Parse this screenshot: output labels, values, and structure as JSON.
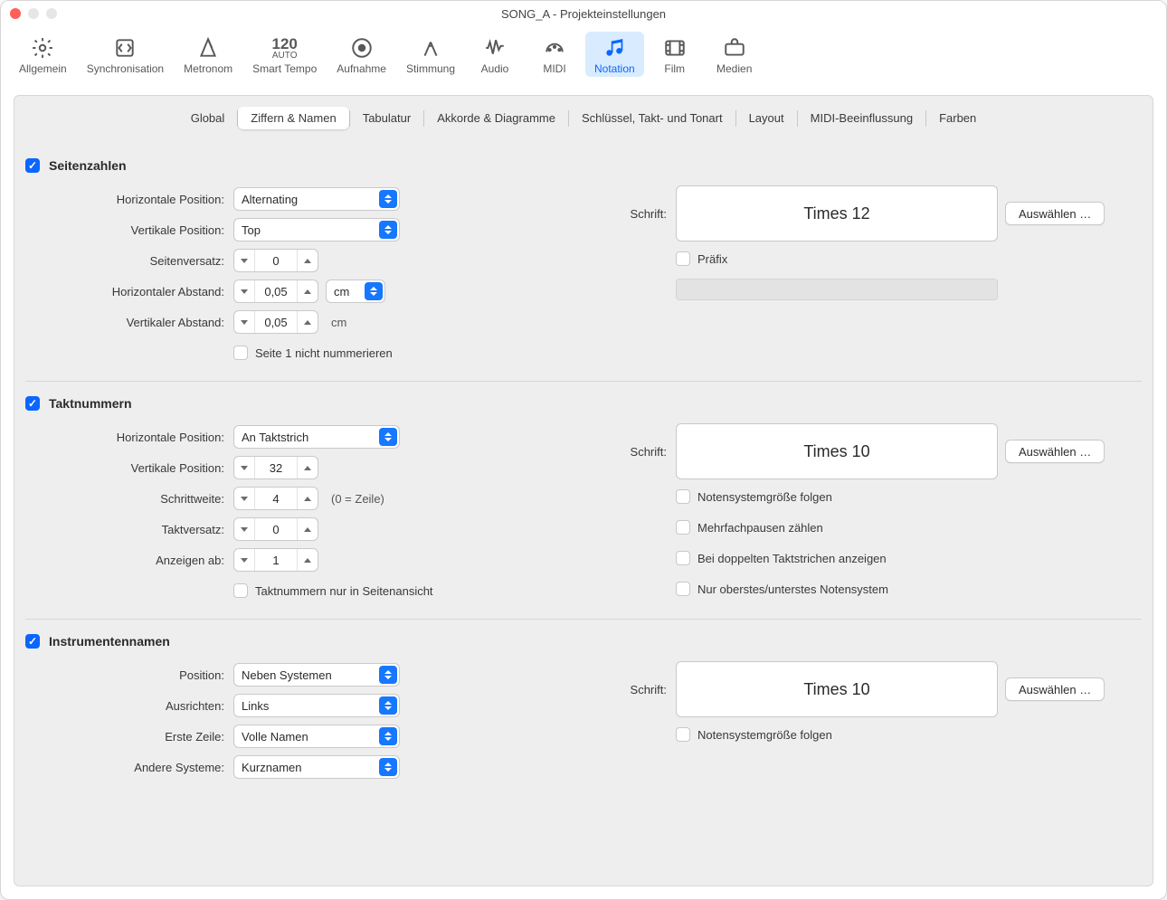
{
  "window": {
    "title": "SONG_A - Projekteinstellungen"
  },
  "toolbar": {
    "items": [
      {
        "label": "Allgemein",
        "icon": "gear"
      },
      {
        "label": "Synchronisation",
        "icon": "sync"
      },
      {
        "label": "Metronom",
        "icon": "metronome"
      },
      {
        "label": "Smart Tempo",
        "icon": "auto120"
      },
      {
        "label": "Aufnahme",
        "icon": "record"
      },
      {
        "label": "Stimmung",
        "icon": "fork"
      },
      {
        "label": "Audio",
        "icon": "wave"
      },
      {
        "label": "MIDI",
        "icon": "midi"
      },
      {
        "label": "Notation",
        "icon": "notes"
      },
      {
        "label": "Film",
        "icon": "film"
      },
      {
        "label": "Medien",
        "icon": "case"
      }
    ],
    "activeIndex": 8
  },
  "subtabs": [
    "Global",
    "Ziffern & Namen",
    "Tabulatur",
    "Akkorde & Diagramme",
    "Schlüssel, Takt- und Tonart",
    "Layout",
    "MIDI-Beeinflussung",
    "Farben"
  ],
  "subtabActive": 1,
  "pageNumbers": {
    "title": "Seitenzahlen",
    "checked": true,
    "hPosLabel": "Horizontale Position:",
    "hPosValue": "Alternating",
    "vPosLabel": "Vertikale Position:",
    "vPosValue": "Top",
    "offsetLabel": "Seitenversatz:",
    "offsetValue": "0",
    "hDistLabel": "Horizontaler Abstand:",
    "hDistValue": "0,05",
    "hUnit": "cm",
    "vDistLabel": "Vertikaler Abstand:",
    "vDistValue": "0,05",
    "vUnit": "cm",
    "skipFirstLabel": "Seite 1 nicht nummerieren",
    "skipFirstChecked": false,
    "fontLabel": "Schrift:",
    "fontSample": "Times 12",
    "selectBtn": "Auswählen …",
    "prefixLabel": "Präfix",
    "prefixChecked": false,
    "prefixValue": ""
  },
  "barNumbers": {
    "title": "Taktnummern",
    "checked": true,
    "hPosLabel": "Horizontale Position:",
    "hPosValue": "An Taktstrich",
    "vPosLabel": "Vertikale Position:",
    "vPosValue": "32",
    "stepLabel": "Schrittweite:",
    "stepValue": "4",
    "stepHint": "(0 = Zeile)",
    "barOffsetLabel": "Taktversatz:",
    "barOffsetValue": "0",
    "fromLabel": "Anzeigen ab:",
    "fromValue": "1",
    "onlyPageLabel": "Taktnummern nur in Seitenansicht",
    "onlyPageChecked": false,
    "fontLabel": "Schrift:",
    "fontSample": "Times 10",
    "selectBtn": "Auswählen …",
    "followSizeLabel": "Notensystemgröße folgen",
    "followSizeChecked": false,
    "multiRestLabel": "Mehrfachpausen zählen",
    "multiRestChecked": false,
    "doubleBarLabel": "Bei doppelten Taktstrichen anzeigen",
    "doubleBarChecked": false,
    "topBottomLabel": "Nur oberstes/unterstes Notensystem",
    "topBottomChecked": false
  },
  "instrNames": {
    "title": "Instrumentennamen",
    "checked": true,
    "posLabel": "Position:",
    "posValue": "Neben Systemen",
    "alignLabel": "Ausrichten:",
    "alignValue": "Links",
    "firstLabel": "Erste Zeile:",
    "firstValue": "Volle Namen",
    "otherLabel": "Andere Systeme:",
    "otherValue": "Kurznamen",
    "fontLabel": "Schrift:",
    "fontSample": "Times 10",
    "selectBtn": "Auswählen …",
    "followSizeLabel": "Notensystemgröße folgen",
    "followSizeChecked": false
  }
}
